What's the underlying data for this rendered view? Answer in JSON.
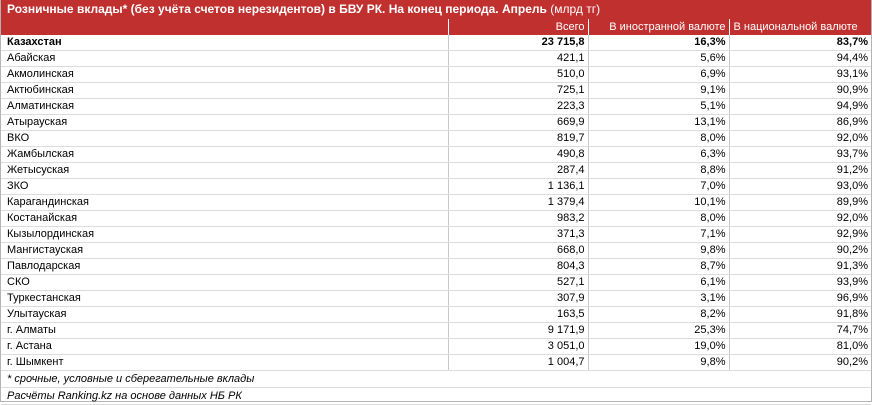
{
  "header": {
    "title": "Розничные вклады* (без учёта счетов нерезидентов) в БВУ РК. На конец периода. Апрель",
    "unit": "(млрд тг)"
  },
  "columns": [
    "",
    "Всего",
    "В иностранной валюте",
    "В национальной валюте"
  ],
  "rows": [
    {
      "name": "Казахстан",
      "total": "23 715,8",
      "foreign": "16,3%",
      "national": "83,7%"
    },
    {
      "name": "Абайская",
      "total": "421,1",
      "foreign": "5,6%",
      "national": "94,4%"
    },
    {
      "name": "Акмолинская",
      "total": "510,0",
      "foreign": "6,9%",
      "national": "93,1%"
    },
    {
      "name": "Актюбинская",
      "total": "725,1",
      "foreign": "9,1%",
      "national": "90,9%"
    },
    {
      "name": "Алматинская",
      "total": "223,3",
      "foreign": "5,1%",
      "national": "94,9%"
    },
    {
      "name": "Атырауская",
      "total": "669,9",
      "foreign": "13,1%",
      "national": "86,9%"
    },
    {
      "name": "ВКО",
      "total": "819,7",
      "foreign": "8,0%",
      "national": "92,0%"
    },
    {
      "name": "Жамбылская",
      "total": "490,8",
      "foreign": "6,3%",
      "national": "93,7%"
    },
    {
      "name": "Жетысуская",
      "total": "287,4",
      "foreign": "8,8%",
      "national": "91,2%"
    },
    {
      "name": "ЗКО",
      "total": "1 136,1",
      "foreign": "7,0%",
      "national": "93,0%"
    },
    {
      "name": "Карагандинская",
      "total": "1 379,4",
      "foreign": "10,1%",
      "national": "89,9%"
    },
    {
      "name": "Костанайская",
      "total": "983,2",
      "foreign": "8,0%",
      "national": "92,0%"
    },
    {
      "name": "Кызылординская",
      "total": "371,3",
      "foreign": "7,1%",
      "national": "92,9%"
    },
    {
      "name": "Мангистауская",
      "total": "668,0",
      "foreign": "9,8%",
      "national": "90,2%"
    },
    {
      "name": "Павлодарская",
      "total": "804,3",
      "foreign": "8,7%",
      "national": "91,3%"
    },
    {
      "name": "СКО",
      "total": "527,1",
      "foreign": "6,1%",
      "national": "93,9%"
    },
    {
      "name": "Туркестанская",
      "total": "307,9",
      "foreign": "3,1%",
      "national": "96,9%"
    },
    {
      "name": "Улытауская",
      "total": "163,5",
      "foreign": "8,2%",
      "national": "91,8%"
    },
    {
      "name": "г. Алматы",
      "total": "9 171,9",
      "foreign": "25,3%",
      "national": "74,7%"
    },
    {
      "name": "г. Астана",
      "total": "3 051,0",
      "foreign": "19,0%",
      "national": "81,0%"
    },
    {
      "name": "г. Шымкент",
      "total": "1 004,7",
      "foreign": "9,8%",
      "national": "90,2%"
    }
  ],
  "footnotes": [
    "* срочные, условные и сберегательные вклады",
    "Расчёты Ranking.kz на основе данных НБ РК"
  ]
}
